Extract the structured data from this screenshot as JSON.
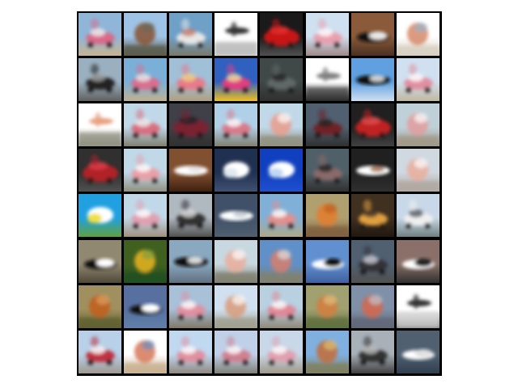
{
  "image": {
    "kind": "sample-image-grid",
    "rows": 8,
    "columns": 8,
    "frame_color": "#000000",
    "page_background": "#ffffff",
    "tiles": [
      {
        "sky": "#8fb6d8",
        "ground": "#c9b48f",
        "obj": "#d86a8a",
        "obj2": "#f0f0f0",
        "shape": "car"
      },
      {
        "sky": "#9ec3e6",
        "ground": "#5a5a4a",
        "obj": "#8a5a3a",
        "obj2": "#6a6a5a",
        "shape": "blob"
      },
      {
        "sky": "#6ea0c8",
        "ground": "#7a7a6a",
        "obj": "#e6e6e6",
        "obj2": "#c87a6a",
        "shape": "car"
      },
      {
        "sky": "#ffffff",
        "ground": "#e8e8e8",
        "obj": "#303030",
        "obj2": "#a0a0a0",
        "shape": "plane"
      },
      {
        "sky": "#1a1a1a",
        "ground": "#505050",
        "obj": "#c81818",
        "obj2": "#e83030",
        "shape": "car-big"
      },
      {
        "sky": "#cfe0f0",
        "ground": "#a08888",
        "obj": "#e8a0b0",
        "obj2": "#ffffff",
        "shape": "car"
      },
      {
        "sky": "#8a5a3a",
        "ground": "#4a3020",
        "obj": "#101010",
        "obj2": "#e8e8e8",
        "shape": "car-flat"
      },
      {
        "sky": "#ffffff",
        "ground": "#d8d0c0",
        "obj": "#d89070",
        "obj2": "#9ab0c8",
        "shape": "blob"
      },
      {
        "sky": "#9ab0c0",
        "ground": "#606060",
        "obj": "#202020",
        "obj2": "#a0a0a0",
        "shape": "car"
      },
      {
        "sky": "#7ab0d8",
        "ground": "#c0b090",
        "obj": "#d87090",
        "obj2": "#e8e8e8",
        "shape": "car"
      },
      {
        "sky": "#a0c0d8",
        "ground": "#b0a080",
        "obj": "#e87a8a",
        "obj2": "#f0d080",
        "shape": "car"
      },
      {
        "sky": "#3060c0",
        "ground": "#f0c020",
        "obj": "#e04080",
        "obj2": "#f0e0a0",
        "shape": "car"
      },
      {
        "sky": "#404848",
        "ground": "#303030",
        "obj": "#606868",
        "obj2": "#202020",
        "shape": "car"
      },
      {
        "sky": "#ffffff",
        "ground": "#202020",
        "obj": "#808080",
        "obj2": "#303030",
        "shape": "plane"
      },
      {
        "sky": "#60a0e0",
        "ground": "#d0e0f0",
        "obj": "#101010",
        "obj2": "#f0f0f0",
        "shape": "plane-wide"
      },
      {
        "sky": "#d0e0f0",
        "ground": "#c0b8a0",
        "obj": "#e090a0",
        "obj2": "#ffffff",
        "shape": "car"
      },
      {
        "sky": "#ffffff",
        "ground": "#a0a090",
        "obj": "#e8a080",
        "obj2": "#808070",
        "shape": "plane"
      },
      {
        "sky": "#c0d8e8",
        "ground": "#808070",
        "obj": "#d87080",
        "obj2": "#f0f0f0",
        "shape": "car"
      },
      {
        "sky": "#404048",
        "ground": "#303030",
        "obj": "#7a2030",
        "obj2": "#202028",
        "shape": "car-big"
      },
      {
        "sky": "#b0d0e8",
        "ground": "#808070",
        "obj": "#d87a8a",
        "obj2": "#ffffff",
        "shape": "car"
      },
      {
        "sky": "#c0d8e8",
        "ground": "#909080",
        "obj": "#e8a090",
        "obj2": "#ffffff",
        "shape": "blob"
      },
      {
        "sky": "#506070",
        "ground": "#303030",
        "obj": "#702028",
        "obj2": "#202020",
        "shape": "car"
      },
      {
        "sky": "#202020",
        "ground": "#404040",
        "obj": "#c02020",
        "obj2": "#e05050",
        "shape": "car-big"
      },
      {
        "sky": "#c0d0d8",
        "ground": "#a09888",
        "obj": "#e0a0a0",
        "obj2": "#ffffff",
        "shape": "blob"
      },
      {
        "sky": "#303030",
        "ground": "#505050",
        "obj": "#b02028",
        "obj2": "#e04048",
        "shape": "car-big"
      },
      {
        "sky": "#c0d8e8",
        "ground": "#909080",
        "obj": "#e8a0a8",
        "obj2": "#ffffff",
        "shape": "car"
      },
      {
        "sky": "#805030",
        "ground": "#402010",
        "obj": "#ffffff",
        "obj2": "#e0e0e0",
        "shape": "plane-wide"
      },
      {
        "sky": "#203050",
        "ground": "#405070",
        "obj": "#ffffff",
        "obj2": "#e0e8f0",
        "shape": "cloud"
      },
      {
        "sky": "#1040c0",
        "ground": "#2050d0",
        "obj": "#ffffff",
        "obj2": "#c0d8f0",
        "shape": "cloud"
      },
      {
        "sky": "#506068",
        "ground": "#303030",
        "obj": "#8a6a6a",
        "obj2": "#202020",
        "shape": "car"
      },
      {
        "sky": "#202020",
        "ground": "#303030",
        "obj": "#ffffff",
        "obj2": "#a07050",
        "shape": "plane-wide"
      },
      {
        "sky": "#d0d8e0",
        "ground": "#b0a8a0",
        "obj": "#e8b0a0",
        "obj2": "#ffffff",
        "shape": "blob"
      },
      {
        "sky": "#20a0e0",
        "ground": "#60a040",
        "obj": "#ffffff",
        "obj2": "#f0e040",
        "shape": "cloud"
      },
      {
        "sky": "#c0d8e8",
        "ground": "#a09080",
        "obj": "#e0a0b0",
        "obj2": "#ffffff",
        "shape": "car"
      },
      {
        "sky": "#b0b8c0",
        "ground": "#505050",
        "obj": "#303030",
        "obj2": "#e0e0e0",
        "shape": "car"
      },
      {
        "sky": "#405068",
        "ground": "#506070",
        "obj": "#ffffff",
        "obj2": "#c0c8d0",
        "shape": "plane-wide"
      },
      {
        "sky": "#80b0d8",
        "ground": "#b0a888",
        "obj": "#e09090",
        "obj2": "#ffffff",
        "shape": "car"
      },
      {
        "sky": "#b0a070",
        "ground": "#806040",
        "obj": "#e08030",
        "obj2": "#c06020",
        "shape": "blob"
      },
      {
        "sky": "#403020",
        "ground": "#201810",
        "obj": "#e0a040",
        "obj2": "#403028",
        "shape": "car"
      },
      {
        "sky": "#c8d8e8",
        "ground": "#708080",
        "obj": "#f0f0f0",
        "obj2": "#505860",
        "shape": "car"
      },
      {
        "sky": "#908870",
        "ground": "#504838",
        "obj": "#101010",
        "obj2": "#ffffff",
        "shape": "car-flat"
      },
      {
        "sky": "#406020",
        "ground": "#205020",
        "obj": "#e0b020",
        "obj2": "#80a040",
        "shape": "blob"
      },
      {
        "sky": "#8aa8c0",
        "ground": "#607080",
        "obj": "#101010",
        "obj2": "#ffffff",
        "shape": "plane-wide"
      },
      {
        "sky": "#c8d8e0",
        "ground": "#808070",
        "obj": "#e8b0a0",
        "obj2": "#ffffff",
        "shape": "blob"
      },
      {
        "sky": "#6090c8",
        "ground": "#808070",
        "obj": "#d08070",
        "obj2": "#e0e0e0",
        "shape": "blob"
      },
      {
        "sky": "#6090d0",
        "ground": "#4060a0",
        "obj": "#ffffff",
        "obj2": "#101010",
        "shape": "car-flat"
      },
      {
        "sky": "#506070",
        "ground": "#505050",
        "obj": "#303038",
        "obj2": "#d0d0d8",
        "shape": "car"
      },
      {
        "sky": "#8a7068",
        "ground": "#303030",
        "obj": "#ffffff",
        "obj2": "#202020",
        "shape": "car-flat"
      },
      {
        "sky": "#a09060",
        "ground": "#606030",
        "obj": "#c06020",
        "obj2": "#e0a060",
        "shape": "blob"
      },
      {
        "sky": "#5870a0",
        "ground": "#6080a8",
        "obj": "#101010",
        "obj2": "#ffffff",
        "shape": "car-flat"
      },
      {
        "sky": "#a8c0d8",
        "ground": "#807868",
        "obj": "#e090a0",
        "obj2": "#ffffff",
        "shape": "car"
      },
      {
        "sky": "#d0e0f0",
        "ground": "#a0a090",
        "obj": "#d8a080",
        "obj2": "#ffffff",
        "shape": "blob"
      },
      {
        "sky": "#b8d0e0",
        "ground": "#908878",
        "obj": "#e08898",
        "obj2": "#ffffff",
        "shape": "car"
      },
      {
        "sky": "#a0a070",
        "ground": "#607040",
        "obj": "#d08040",
        "obj2": "#e0c080",
        "shape": "blob"
      },
      {
        "sky": "#8090a8",
        "ground": "#606878",
        "obj": "#d06850",
        "obj2": "#c0c8d0",
        "shape": "blob"
      },
      {
        "sky": "#ffffff",
        "ground": "#707070",
        "obj": "#303030",
        "obj2": "#e0e0e0",
        "shape": "plane"
      },
      {
        "sky": "#b8d0e8",
        "ground": "#a09890",
        "obj": "#c03040",
        "obj2": "#ffffff",
        "shape": "car"
      },
      {
        "sky": "#ffffff",
        "ground": "#c8b090",
        "obj": "#d88060",
        "obj2": "#6a90c0",
        "shape": "blob"
      },
      {
        "sky": "#c0d8f0",
        "ground": "#908880",
        "obj": "#e090a0",
        "obj2": "#ffffff",
        "shape": "car"
      },
      {
        "sky": "#c0d0e8",
        "ground": "#808078",
        "obj": "#d08090",
        "obj2": "#ffffff",
        "shape": "car"
      },
      {
        "sky": "#c8d8e8",
        "ground": "#a09888",
        "obj": "#e0a0b0",
        "obj2": "#ffffff",
        "shape": "car"
      },
      {
        "sky": "#80b0e0",
        "ground": "#808060",
        "obj": "#c07040",
        "obj2": "#e0c070",
        "shape": "blob"
      },
      {
        "sky": "#a8b0b8",
        "ground": "#404040",
        "obj": "#303030",
        "obj2": "#c0c0c0",
        "shape": "car"
      },
      {
        "sky": "#506070",
        "ground": "#304050",
        "obj": "#ffffff",
        "obj2": "#e0e0e0",
        "shape": "car-flat"
      }
    ]
  }
}
